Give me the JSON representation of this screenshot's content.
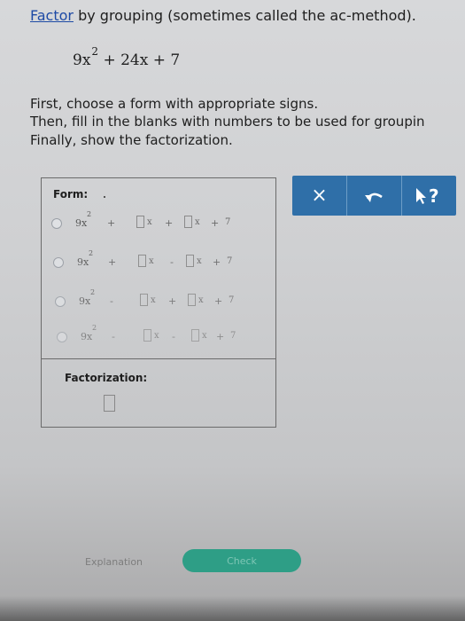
{
  "title": {
    "link": "Factor",
    "rest": " by grouping (sometimes called the ac-method)."
  },
  "expression": {
    "lead": "9x",
    "exponent": "2",
    "tail": " + 24x + 7"
  },
  "instructions": [
    "First, choose a form with appropriate signs.",
    "Then, fill in the blanks with numbers to be used for groupin",
    "Finally, show the factorization."
  ],
  "form": {
    "label": "Form:",
    "rows": [
      {
        "term": "9x",
        "exp": "2",
        "op1": "+",
        "op2": "+",
        "op3": "+",
        "x": "x",
        "const": "7"
      },
      {
        "term": "9x",
        "exp": "2",
        "op1": "+",
        "op2": "-",
        "op3": "+",
        "x": "x",
        "const": "7"
      },
      {
        "term": "9x",
        "exp": "2",
        "op1": "-",
        "op2": "+",
        "op3": "+",
        "x": "x",
        "const": "7"
      },
      {
        "term": "9x",
        "exp": "2",
        "op1": "-",
        "op2": "-",
        "op3": "+",
        "x": "x",
        "const": "7"
      }
    ]
  },
  "factorization": {
    "label": "Factorization:"
  },
  "toolbar": {
    "clear_icon": "×",
    "undo": "undo-icon",
    "help": "help-cursor-icon"
  },
  "bottom": {
    "explanation_label": "Explanation",
    "check_label": "Check"
  },
  "colors": {
    "toolbar": "#2f6fa8",
    "check": "#2e9e86",
    "link": "#1d4aa5"
  }
}
